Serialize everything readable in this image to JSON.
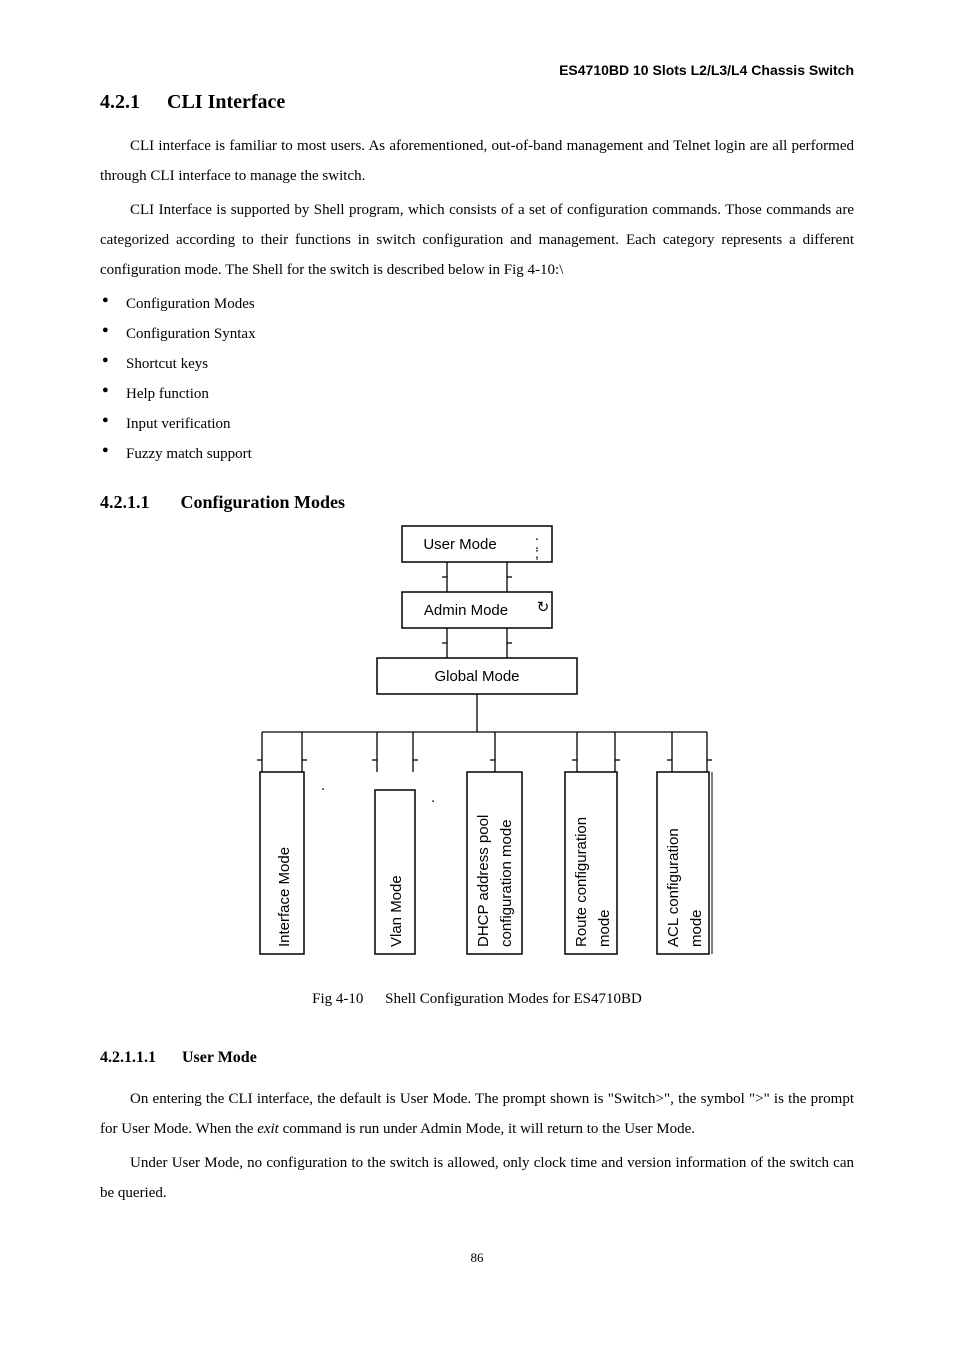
{
  "running_header": "ES4710BD 10 Slots L2/L3/L4 Chassis Switch",
  "h421_num": "4.2.1",
  "h421_title": "CLI Interface",
  "para1": "CLI interface is familiar to most users. As aforementioned, out-of-band management and Telnet login are all performed through CLI interface to manage the switch.",
  "para2": "CLI Interface is supported by Shell program, which consists of a set of configuration commands. Those commands are categorized according to their functions in switch configuration and management. Each category represents a different configuration mode. The Shell for the switch is described below in Fig 4-10:\\",
  "bullets": [
    "Configuration Modes",
    "Configuration Syntax",
    "Shortcut keys",
    "Help function",
    "Input verification",
    "Fuzzy match support"
  ],
  "h4211_num": "4.2.1.1",
  "h4211_title": "Configuration Modes",
  "diagram": {
    "user_mode": "User Mode",
    "admin_mode": "Admin Mode",
    "global_mode": "Global Mode",
    "leaves": [
      "Interface Mode",
      "Vlan Mode",
      "DHCP address pool",
      "configuration mode",
      "Route configuration",
      "mode",
      "ACL configuration",
      "mode"
    ]
  },
  "fig_no": "Fig 4-10",
  "fig_caption": "Shell Configuration Modes for ES4710BD",
  "h42111_num": "4.2.1.1.1",
  "h42111_title": "User Mode",
  "para3a": "On entering the CLI interface, the default is User Mode. The prompt shown is \"Switch>\", the symbol \">\" is the prompt for User Mode. When the ",
  "para3_exit": "exit",
  "para3b": " command is run under Admin Mode, it will return to the User Mode.",
  "para4": "Under User Mode, no configuration to the switch is allowed, only clock time and version information of the switch can be queried.",
  "pagenum": "86"
}
